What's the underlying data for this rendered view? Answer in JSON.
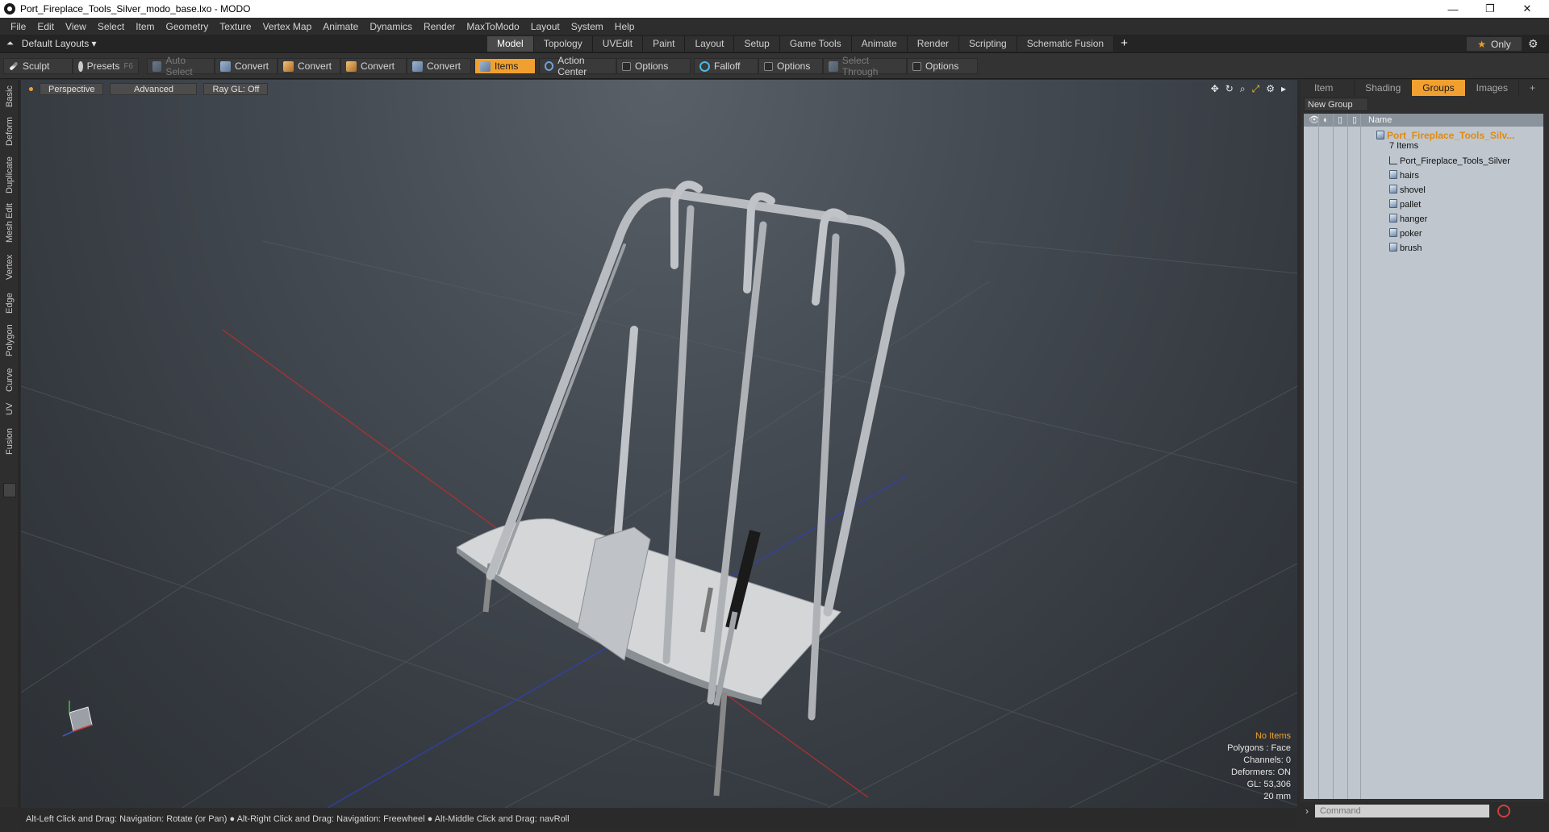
{
  "window": {
    "title": "Port_Fireplace_Tools_Silver_modo_base.lxo - MODO",
    "controls": [
      "—",
      "❐",
      "✕"
    ]
  },
  "menu": [
    "File",
    "Edit",
    "View",
    "Select",
    "Item",
    "Geometry",
    "Texture",
    "Vertex Map",
    "Animate",
    "Dynamics",
    "Render",
    "MaxToModo",
    "Layout",
    "System",
    "Help"
  ],
  "layout_bar": {
    "layout_label": "Default Layouts ▾",
    "tabs": [
      "Model",
      "Topology",
      "UVEdit",
      "Paint",
      "Layout",
      "Setup",
      "Game Tools",
      "Animate",
      "Render",
      "Scripting",
      "Schematic Fusion"
    ],
    "active_tab": "Model",
    "plus": "+",
    "only_label": "Only"
  },
  "toolbar": {
    "sculpt": "Sculpt",
    "presets": "Presets",
    "presets_key": "F6",
    "auto_select": "Auto Select",
    "convert1": "Convert",
    "convert2": "Convert",
    "convert3": "Convert",
    "convert4": "Convert",
    "items": "Items",
    "action_center": "Action Center",
    "options1": "Options",
    "falloff": "Falloff",
    "options2": "Options",
    "select_through": "Select Through",
    "options3": "Options"
  },
  "left_tabs": [
    "Basic",
    "Deform",
    "Duplicate",
    "Mesh Edit",
    "Vertex",
    "Edge",
    "Polygon",
    "Curve",
    "UV",
    "Fusion"
  ],
  "viewport": {
    "view_mode": "Perspective",
    "shading": "Advanced",
    "raygl": "Ray GL: Off",
    "info": {
      "selection": "No Items",
      "polygons": "Polygons : Face",
      "channels": "Channels: 0",
      "deformers": "Deformers: ON",
      "gl": "GL: 53,306",
      "scale": "20 mm"
    }
  },
  "status": "Alt-Left Click and Drag: Navigation: Rotate (or Pan) ● Alt-Right Click and Drag: Navigation: Freewheel ● Alt-Middle Click and Drag: navRoll",
  "right_panel": {
    "tabs": [
      "Item List",
      "Shading",
      "Groups",
      "Images",
      "+"
    ],
    "active_tab": "Groups",
    "new_group": "New Group",
    "column_name": "Name",
    "group": {
      "name": "Port_Fireplace_Tools_Silv...",
      "count": "7 Items"
    },
    "items": [
      "Port_Fireplace_Tools_Silver",
      "hairs",
      "shovel",
      "pallet",
      "hanger",
      "poker",
      "brush"
    ],
    "command_placeholder": "Command"
  },
  "colors": {
    "accent": "#f0a030",
    "viewport_bg": "#464c54",
    "tree_bg": "#bfc6ce"
  }
}
